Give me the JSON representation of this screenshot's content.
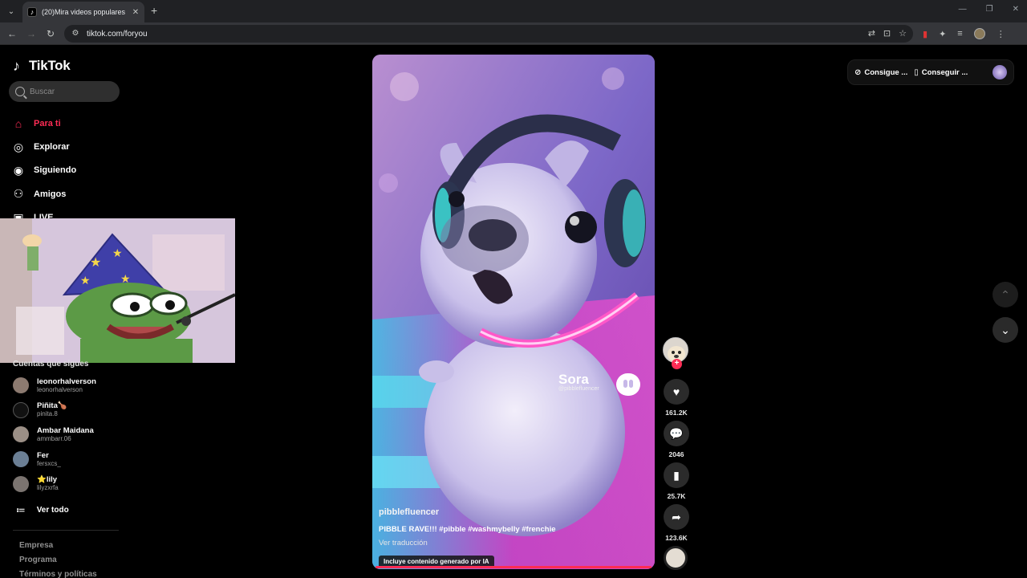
{
  "browser": {
    "tab_title": "(20)Mira videos populares sele",
    "url": "tiktok.com/foryou"
  },
  "tiktok": {
    "logo_text": "TikTok",
    "search_placeholder": "Buscar",
    "nav": [
      {
        "label": "Para ti",
        "icon": "home-icon",
        "active": true
      },
      {
        "label": "Explorar",
        "icon": "compass-icon",
        "active": false
      },
      {
        "label": "Siguiendo",
        "icon": "following-icon",
        "active": false
      },
      {
        "label": "Amigos",
        "icon": "friends-icon",
        "active": false
      },
      {
        "label": "LIVE",
        "icon": "live-tv-icon",
        "active": false
      }
    ],
    "following_title": "Cuentas que sigues",
    "following": [
      {
        "name": "leonorhalverson",
        "handle": "leonorhalverson"
      },
      {
        "name": "Piñita🍗",
        "handle": "pinita.8"
      },
      {
        "name": "Ambar Maidana",
        "handle": "ammbarr.06"
      },
      {
        "name": "Fer",
        "handle": "fersxcs_"
      },
      {
        "name": "⭐lily",
        "handle": "lilyzxrfa"
      }
    ],
    "see_all": "Ver todo",
    "footer_links": [
      "Empresa",
      "Programa",
      "Términos y políticas"
    ],
    "top_right": {
      "coins_label": "Consigue ...",
      "app_label": "Conseguir ..."
    }
  },
  "video": {
    "author": "pibblefluencer",
    "caption": "PIBBLE RAVE!!! #pibble #washmybelly #frenchie",
    "translate": "Ver traducción",
    "ai_badge": "Incluye contenido generado por IA",
    "watermark_word": "Sora",
    "watermark_handle": "@pibblefluencer",
    "progress_fraction": 1.0,
    "likes": "161.2K",
    "comments": "2046",
    "saves": "25.7K",
    "shares": "123.6K"
  },
  "colors": {
    "accent": "#fe2c55",
    "background": "#000000"
  }
}
